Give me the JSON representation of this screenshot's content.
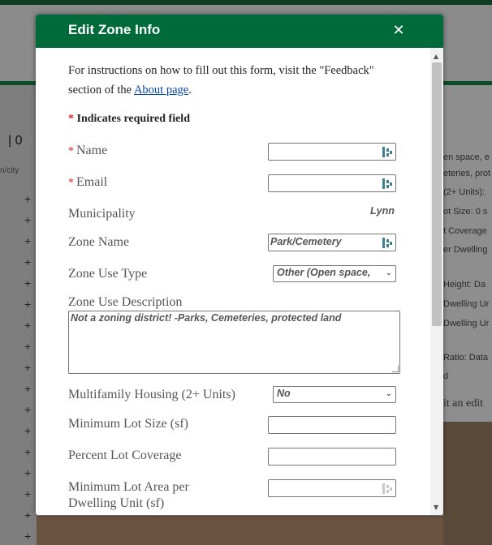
{
  "background": {
    "left_count": "| 0",
    "left_city": "n/city",
    "right_snippets": [
      "en space, e",
      "eteries, prot",
      "(2+ Units):",
      "ot Size: 0 s",
      "t Coverage",
      "er Dwelling",
      "Height: Da",
      "Dwelling Ur",
      "Dwelling Ur",
      "Ratio: Data",
      "d",
      "it an edit"
    ]
  },
  "modal": {
    "title": "Edit Zone Info",
    "close_icon": "close-icon",
    "intro_text_1": "For instructions on how to fill out this form, visit the \"Feedback\" section of the ",
    "intro_link": "About page",
    "intro_text_2": ".",
    "required_note": "Indicates required field",
    "required_marker": "*",
    "fields": {
      "name": {
        "label": "Name",
        "value": ""
      },
      "email": {
        "label": "Email",
        "value": ""
      },
      "municipality": {
        "label": "Municipality",
        "value": "Lynn"
      },
      "zone_name": {
        "label": "Zone Name",
        "value": "Park/Cemetery"
      },
      "zone_use_type": {
        "label": "Zone Use Type",
        "value": "Other (Open space,"
      },
      "zone_use_description": {
        "label": "Zone Use Description",
        "value": "Not a zoning district! -Parks, Cemeteries, protected land"
      },
      "multifamily": {
        "label": "Multifamily Housing (2+ Units)",
        "value": "No"
      },
      "min_lot_size": {
        "label": "Minimum Lot Size (sf)",
        "value": ""
      },
      "pct_lot_coverage": {
        "label": "Percent Lot Coverage",
        "value": ""
      },
      "min_lot_area": {
        "label_1": "Minimum Lot Area per",
        "label_2": "Dwelling Unit (sf)",
        "value": ""
      }
    }
  },
  "colors": {
    "header_green": "#006b3a",
    "required_red": "#d22",
    "link_blue": "#0645ad"
  }
}
